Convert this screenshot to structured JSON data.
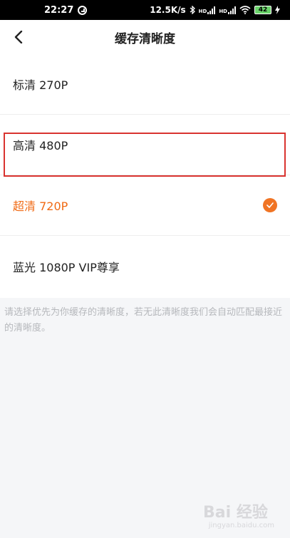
{
  "status_bar": {
    "time": "22:27",
    "speed": "12.5K/s",
    "battery": "42",
    "hd_label": "HD"
  },
  "header": {
    "title": "缓存清晰度"
  },
  "options": [
    {
      "label": "标清 270P",
      "selected": false
    },
    {
      "label": "高清 480P",
      "selected": false
    },
    {
      "label": "超清 720P",
      "selected": true
    },
    {
      "label": "蓝光 1080P  VIP尊享",
      "selected": false
    }
  ],
  "hint": "请选择优先为你缓存的清晰度，若无此清晰度我们会自动匹配最接近的清晰度。",
  "watermark": {
    "text": "Bai 经验",
    "sub": "jingyan.baidu.com"
  },
  "colors": {
    "accent": "#f06a14",
    "highlight_frame": "#d9332f",
    "hint_text": "#b6b8bc"
  }
}
